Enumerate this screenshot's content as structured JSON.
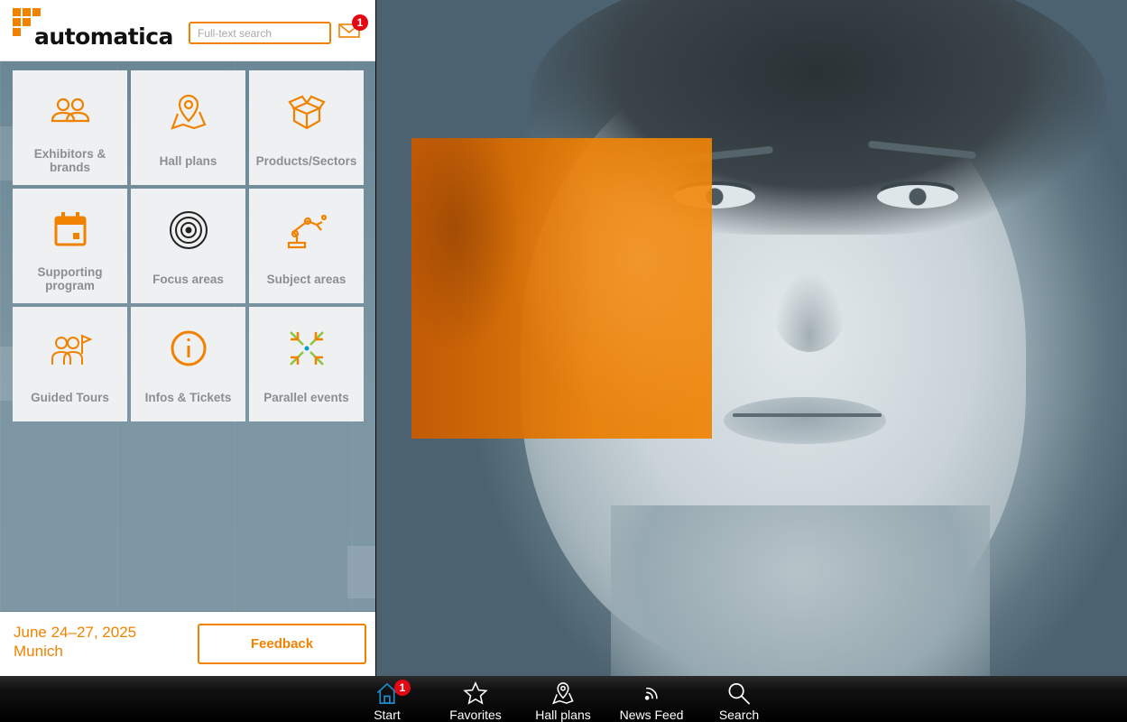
{
  "header": {
    "logo_text": "automatica",
    "search_placeholder": "Full-text search",
    "mail_badge": "1"
  },
  "tiles": [
    {
      "label": "Exhibitors & brands",
      "icon": "people-icon"
    },
    {
      "label": "Hall plans",
      "icon": "map-pin-icon"
    },
    {
      "label": "Products/Sectors",
      "icon": "box-icon"
    },
    {
      "label": "Supporting program",
      "icon": "calendar-icon"
    },
    {
      "label": "Focus areas",
      "icon": "target-icon"
    },
    {
      "label": "Subject areas",
      "icon": "robot-arm-icon"
    },
    {
      "label": "Guided Tours",
      "icon": "tour-guide-icon"
    },
    {
      "label": "Infos & Tickets",
      "icon": "info-icon"
    },
    {
      "label": "Parallel events",
      "icon": "parallel-events-icon"
    }
  ],
  "footer": {
    "date_line1": "June 24–27, 2025",
    "date_line2": "Munich",
    "feedback_label": "Feedback"
  },
  "tabbar": {
    "items": [
      {
        "label": "Start",
        "icon": "home-icon",
        "badge": "1",
        "active": true
      },
      {
        "label": "Favorites",
        "icon": "star-icon"
      },
      {
        "label": "Hall plans",
        "icon": "map-pin-icon"
      },
      {
        "label": "News Feed",
        "icon": "rss-icon"
      },
      {
        "label": "Search",
        "icon": "search-icon"
      }
    ]
  },
  "colors": {
    "accent": "#f08200",
    "badge": "#e30613",
    "tile_bg": "#eef0f1",
    "tile_text": "#8a8f92",
    "active_tab": "#1e88c8"
  }
}
